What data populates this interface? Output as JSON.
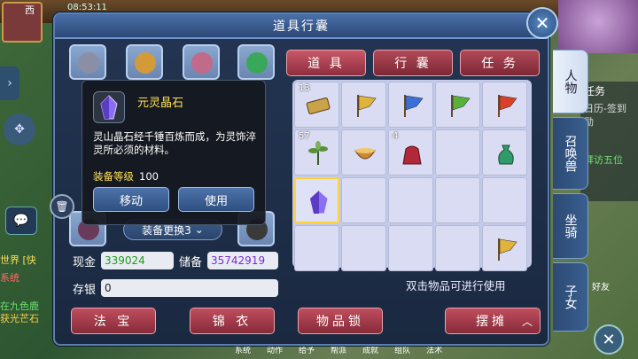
{
  "background": {
    "map_name": "西",
    "clock": "08:53:11",
    "chat_log": [
      "世界 [快",
      "系统",
      "在九色鹿",
      "获光芒石"
    ],
    "chat_log_tags": [
      "世界",
      "系统",
      "世界"
    ],
    "quest_panel": {
      "title": "任务",
      "lines": [
        "日历-签到",
        "励",
        "拜访五位"
      ]
    },
    "friend_label": "好友",
    "bottom_menu": [
      "系统",
      "动作",
      "给予",
      "帮派",
      "成就",
      "组队",
      "法术"
    ]
  },
  "panel": {
    "title": "道具行囊",
    "tabs": [
      {
        "label": "道 具",
        "active": true
      },
      {
        "label": "行 囊",
        "active": false
      },
      {
        "label": "任 务",
        "active": false
      }
    ],
    "side_tabs": [
      {
        "label": "人物",
        "active": true
      },
      {
        "label": "召唤兽",
        "active": false
      },
      {
        "label": "坐骑",
        "active": false
      },
      {
        "label": "子女",
        "active": false
      }
    ],
    "equip_switch_label": "装备更换3",
    "currency": {
      "cash_label": "现金",
      "cash_value": "339024",
      "reserve_label": "储备",
      "reserve_value": "35742919",
      "bank_label": "存银",
      "bank_value": "0"
    },
    "hint": "双击物品可进行使用",
    "bottom_buttons": [
      "法 宝",
      "锦 衣",
      "物品锁",
      "摆摊"
    ],
    "tooltip": {
      "item_name": "元灵晶石",
      "description": "灵山晶石经千锤百炼而成，为灵饰淬灵所必须的材料。",
      "level_label": "装备等级",
      "level_value": "100",
      "move_button": "移动",
      "use_button": "使用"
    },
    "inventory": [
      {
        "name": "scroll",
        "count": "13",
        "color": "#c9a24a"
      },
      {
        "name": "flag-yellow",
        "count": "",
        "color": "#e0b43a"
      },
      {
        "name": "flag-blue",
        "count": "",
        "color": "#3a6fd8"
      },
      {
        "name": "flag-green",
        "count": "",
        "color": "#58b23a"
      },
      {
        "name": "flag-red",
        "count": "",
        "color": "#d8402a"
      },
      {
        "name": "herb",
        "count": "57",
        "color": "#5a8f3a"
      },
      {
        "name": "bowl",
        "count": "",
        "color": "#c88a3a"
      },
      {
        "name": "bag-red",
        "count": "4",
        "color": "#b0283a"
      },
      {
        "name": "empty",
        "count": "",
        "color": ""
      },
      {
        "name": "pouch-green",
        "count": "",
        "color": "#2f9a6a"
      },
      {
        "name": "crystal",
        "count": "",
        "color": "#7a5ad8",
        "selected": true
      },
      {
        "name": "empty",
        "count": "",
        "color": ""
      },
      {
        "name": "empty",
        "count": "",
        "color": ""
      },
      {
        "name": "empty",
        "count": "",
        "color": ""
      },
      {
        "name": "empty",
        "count": "",
        "color": ""
      },
      {
        "name": "empty",
        "count": "",
        "color": ""
      },
      {
        "name": "empty",
        "count": "",
        "color": ""
      },
      {
        "name": "empty",
        "count": "",
        "color": ""
      },
      {
        "name": "empty",
        "count": "",
        "color": ""
      },
      {
        "name": "flag-yellow",
        "count": "",
        "color": "#e0b43a"
      }
    ]
  }
}
